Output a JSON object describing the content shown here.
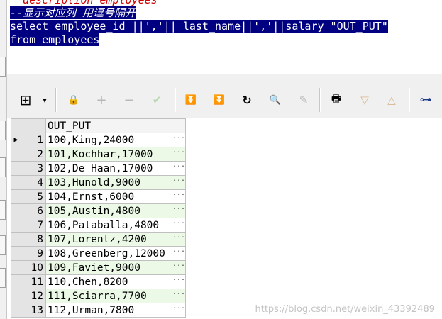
{
  "editor": {
    "lines": [
      {
        "text": "  description employees",
        "style": "comment-red"
      },
      {
        "text": "--显示对应列 用逗号隔开",
        "style": "selected-comment"
      },
      {
        "text": "select employee_id ||','|| last_name||','||salary \"OUT_PUT\"",
        "style": "selected"
      },
      {
        "text": "from employees",
        "style": "selected"
      }
    ]
  },
  "toolbar": {
    "buttons": [
      {
        "icon": "grid-select-icon",
        "glyph": "⊞"
      },
      {
        "icon": "dropdown-arrow-icon",
        "glyph": "▾"
      },
      {
        "icon": "lock-icon",
        "glyph": "🔒"
      },
      {
        "icon": "plus-icon",
        "glyph": "+"
      },
      {
        "icon": "minus-icon",
        "glyph": "−"
      },
      {
        "icon": "check-icon",
        "glyph": "✔"
      },
      {
        "icon": "fetch-next-icon",
        "glyph": "⏬"
      },
      {
        "icon": "fetch-last-icon",
        "glyph": "⏬"
      },
      {
        "icon": "refresh-icon",
        "glyph": "↻"
      },
      {
        "icon": "find-icon",
        "glyph": "🔍"
      },
      {
        "icon": "eraser-icon",
        "glyph": "✎"
      },
      {
        "icon": "print-icon",
        "glyph": "🖶"
      },
      {
        "icon": "triangle-down-icon",
        "glyph": "▽"
      },
      {
        "icon": "triangle-up-icon",
        "glyph": "△"
      },
      {
        "icon": "tree-icon",
        "glyph": "⊶"
      }
    ]
  },
  "grid": {
    "column_header": "OUT_PUT",
    "current_row": 1,
    "ellipsis": "...",
    "rows": [
      {
        "n": "1",
        "value": "100,King,24000"
      },
      {
        "n": "2",
        "value": "101,Kochhar,17000"
      },
      {
        "n": "3",
        "value": "102,De Haan,17000"
      },
      {
        "n": "4",
        "value": "103,Hunold,9000"
      },
      {
        "n": "5",
        "value": "104,Ernst,6000"
      },
      {
        "n": "6",
        "value": "105,Austin,4800"
      },
      {
        "n": "7",
        "value": "106,Pataballa,4800"
      },
      {
        "n": "8",
        "value": "107,Lorentz,4200"
      },
      {
        "n": "9",
        "value": "108,Greenberg,12000"
      },
      {
        "n": "10",
        "value": "109,Faviet,9000"
      },
      {
        "n": "11",
        "value": "110,Chen,8200"
      },
      {
        "n": "12",
        "value": "111,Sciarra,7700"
      },
      {
        "n": "13",
        "value": "112,Urman,7800"
      }
    ]
  },
  "watermark": "https://blog.csdn.net/weixin_43392489",
  "colors": {
    "selection": "#000080",
    "comment": "#d40000",
    "even_row": "#ebf9e6",
    "green_icon": "#1a8a1a"
  }
}
